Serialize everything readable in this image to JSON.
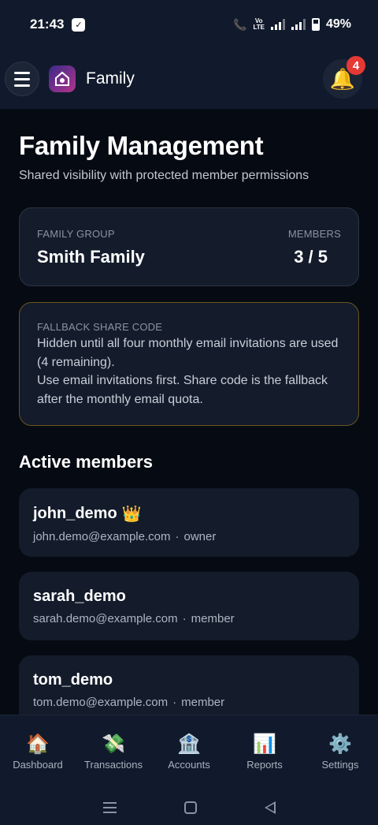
{
  "status_bar": {
    "time": "21:43",
    "network": "Vo LTE",
    "battery": "49%"
  },
  "header": {
    "title": "Family",
    "notification_count": "4"
  },
  "page": {
    "title": "Family Management",
    "subtitle": "Shared visibility with protected member permissions"
  },
  "group_card": {
    "group_label": "FAMILY GROUP",
    "group_name": "Smith Family",
    "members_label": "MEMBERS",
    "members_value": "3 / 5"
  },
  "fallback_card": {
    "label": "FALLBACK SHARE CODE",
    "line1": "Hidden until all four monthly email invitations are used (4 remaining).",
    "line2": "Use email invitations first. Share code is the fallback after the monthly email quota."
  },
  "members_section": {
    "title": "Active members",
    "members": [
      {
        "name": "john_demo",
        "badge": "👑",
        "email": "john.demo@example.com",
        "role": "owner"
      },
      {
        "name": "sarah_demo",
        "badge": "",
        "email": "sarah.demo@example.com",
        "role": "member"
      },
      {
        "name": "tom_demo",
        "badge": "",
        "email": "tom.demo@example.com",
        "role": "member"
      }
    ],
    "separator": "·"
  },
  "bottom_nav": {
    "items": [
      {
        "icon": "🏠",
        "icon_name": "house-icon",
        "label": "Dashboard"
      },
      {
        "icon": "💸",
        "icon_name": "money-flying-icon",
        "label": "Transactions"
      },
      {
        "icon": "🏦",
        "icon_name": "bank-icon",
        "label": "Accounts"
      },
      {
        "icon": "📊",
        "icon_name": "bar-chart-icon",
        "label": "Reports"
      },
      {
        "icon": "⚙️",
        "icon_name": "gear-icon",
        "label": "Settings"
      }
    ]
  },
  "colors": {
    "background": "#060a12",
    "surface": "#141c2b",
    "header": "#111a2c",
    "warning_border": "#6b5420",
    "badge": "#e53935"
  }
}
